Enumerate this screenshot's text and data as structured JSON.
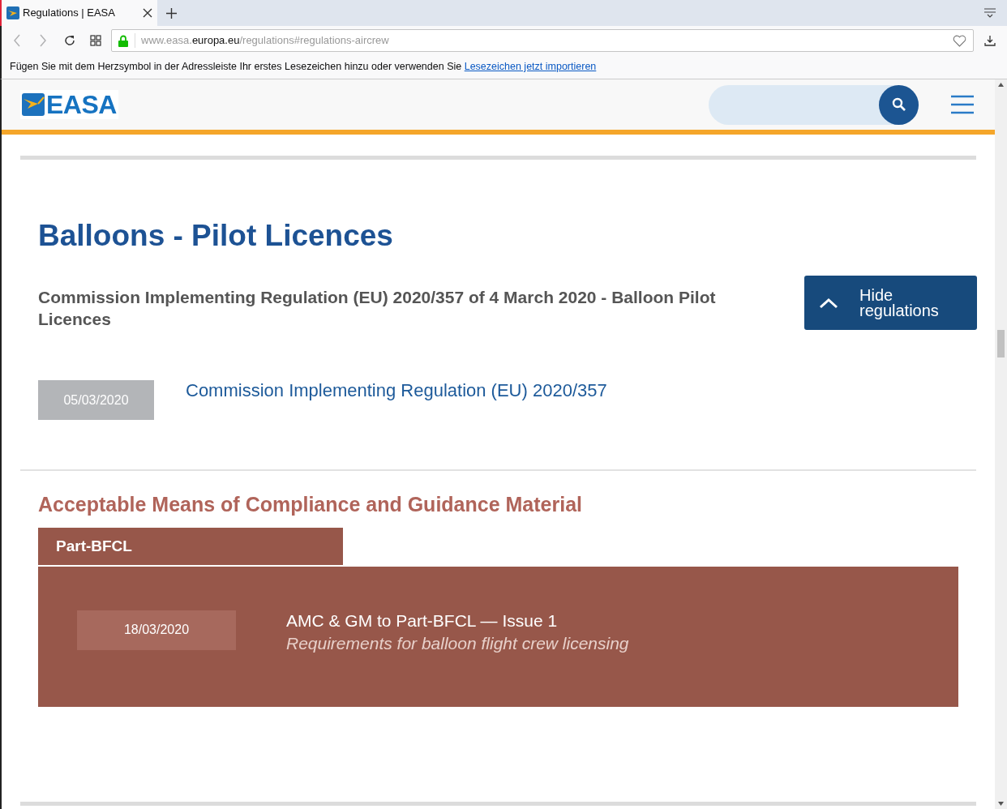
{
  "browser": {
    "tab": {
      "title": "Regulations | EASA"
    },
    "address": {
      "prefix": "www.easa.",
      "domain": "europa.eu",
      "path": "/regulations#regulations-aircrew"
    },
    "bookmark_notice": {
      "text": "Fügen Sie mit dem Herzsymbol in der Adressleiste Ihr erstes Lesezeichen hinzu oder verwenden Sie",
      "link": "Lesezeichen jetzt importieren"
    }
  },
  "site": {
    "logo": "EASA"
  },
  "page": {
    "title": "Balloons - Pilot Licences",
    "regulation_group": {
      "title": "Commission Implementing Regulation (EU) 2020/357 of 4 March 2020 - Balloon Pilot Licences",
      "toggle_button": "Hide regulations",
      "expanded": true,
      "items": [
        {
          "date": "05/03/2020",
          "title": "Commission Implementing Regulation (EU) 2020/357"
        }
      ]
    },
    "amc_section": {
      "heading": "Acceptable Means of Compliance and Guidance Material",
      "tabs": [
        {
          "label": "Part-BFCL",
          "selected": true
        }
      ],
      "documents": [
        {
          "date": "18/03/2020",
          "title": "AMC & GM to Part-BFCL — Issue 1",
          "subtitle": "Requirements for balloon flight crew licensing"
        }
      ]
    }
  }
}
